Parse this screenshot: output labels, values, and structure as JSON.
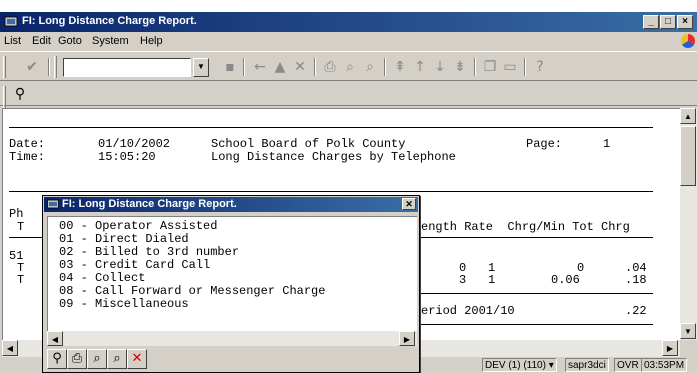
{
  "window": {
    "title": "FI: Long Distance Charge Report.",
    "controls": {
      "minimize": "_",
      "maximize": "□",
      "close": "×"
    }
  },
  "menu": [
    "List",
    "Edit",
    "Goto",
    "System",
    "Help"
  ],
  "toolbar": {
    "command_value": "",
    "icons": [
      "check-icon",
      "save-icon",
      "back-icon",
      "exit-icon",
      "cancel-icon",
      "print-icon",
      "find-icon",
      "find-next-icon",
      "first-page-icon",
      "prev-page-icon",
      "next-page-icon",
      "last-page-icon",
      "create-session-icon",
      "shortcut-icon",
      "help-icon"
    ]
  },
  "report": {
    "date_label": "Date:",
    "date_value": "01/10/2002",
    "org_name": "School Board of Polk County",
    "page_label": "Page:",
    "page_value": "1",
    "time_label": "Time:",
    "time_value": "15:05:20",
    "subtitle": "Long Distance Charges by Telephone",
    "col_ph": "Ph",
    "col_t": "T",
    "columns_right": "ength Rate  Chrg/Min Tot Chrg",
    "row1_left": "51",
    "rows_left": [
      "T",
      "T"
    ],
    "rows": [
      {
        "length": "0",
        "rate": "1",
        "chrg_min": "0",
        "tot_chrg": ".04"
      },
      {
        "length": "3",
        "rate": "1",
        "chrg_min": "0.06",
        "tot_chrg": ".18"
      }
    ],
    "period_text": "eriod 2001/10",
    "period_total": ".22"
  },
  "popup": {
    "title": "FI: Long Distance Charge Report.",
    "items": [
      "00 - Operator Assisted",
      "01 - Direct Dialed",
      "02 - Billed to 3rd number",
      "03 - Credit Card Call",
      "04 - Collect",
      "08 - Call Forward or Messenger Charge",
      "09 - Miscellaneous"
    ]
  },
  "status": {
    "system": "DEV (1) (110)",
    "server": "sapr3dci",
    "mode": "OVR",
    "time": "03:53PM"
  }
}
